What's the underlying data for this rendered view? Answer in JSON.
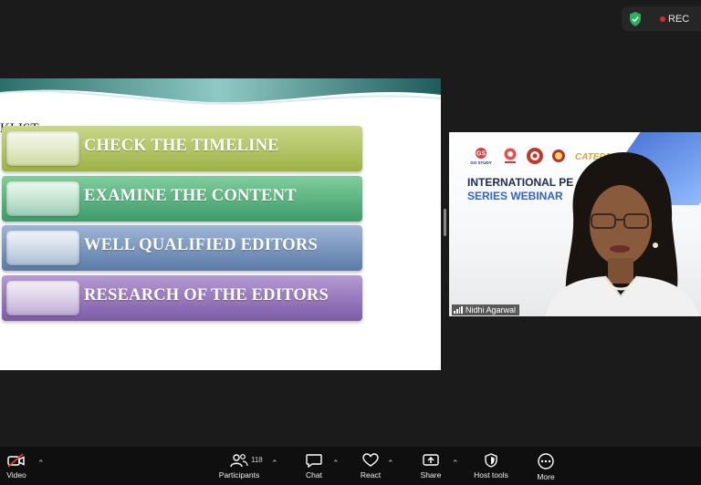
{
  "recording": {
    "label": "REC",
    "dot_color": "#e02828"
  },
  "slide": {
    "title_fragment": "KLIST",
    "items": [
      {
        "label": "CHECK THE TIMELINE"
      },
      {
        "label": "EXAMINE THE CONTENT"
      },
      {
        "label": "WELL QUALIFIED EDITORS"
      },
      {
        "label": "RESEARCH OF THE EDITORS"
      }
    ]
  },
  "video_tile": {
    "banner_line1": "INTERNATIONAL PE",
    "banner_line2": "SERIES WEBINAR",
    "logo_texts": [
      "GO STUDY",
      "CATEDR"
    ],
    "participant_name": "Nidhi Agarwal"
  },
  "toolbar": {
    "video_label": "Video",
    "participants_label": "Participants",
    "participants_count": "118",
    "chat_label": "Chat",
    "react_label": "React",
    "share_label": "Share",
    "host_tools_label": "Host tools",
    "more_label": "More"
  }
}
